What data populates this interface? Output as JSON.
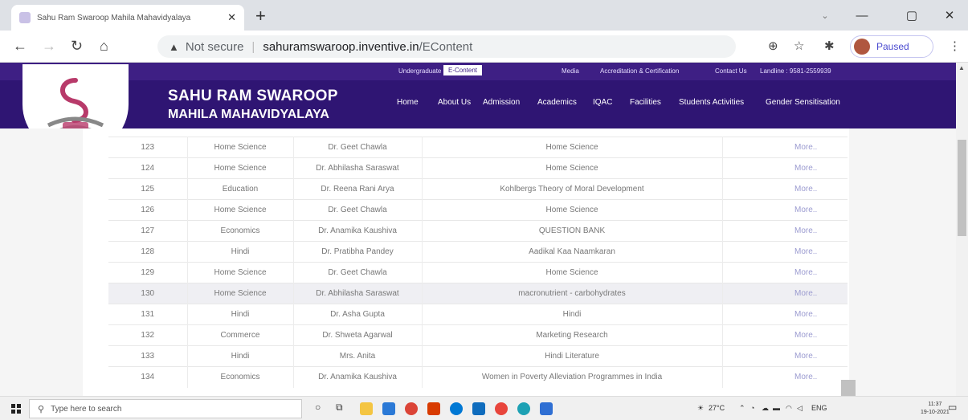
{
  "browser": {
    "tab_title": "Sahu Ram Swaroop Mahila Mahavidyalaya",
    "tab_close": "✕",
    "new_tab": "+",
    "security_label": "Not secure",
    "url_host": "sahuramswaroop.inventive.in",
    "url_path": "/EContent",
    "profile_label": "Paused"
  },
  "site": {
    "topbar": {
      "undergraduate": "Undergraduate",
      "econtent": "E-Content",
      "media": "Media",
      "accreditation": "Accreditation & Certification",
      "contact": "Contact Us",
      "landline": "Landline : 9581-2559939"
    },
    "brand_line1": "SAHU RAM SWAROOP",
    "brand_line2": "MAHILA MAHAVIDYALAYA",
    "nav": [
      "Home",
      "About Us",
      "Admission",
      "Academics",
      "IQAC",
      "Facilities",
      "Students Activities",
      "Gender Sensitisation"
    ]
  },
  "table": {
    "rows": [
      {
        "no": "123",
        "dept": "Home Science",
        "teacher": "Dr. Geet Chawla",
        "topic": "Home Science",
        "link": "More.."
      },
      {
        "no": "124",
        "dept": "Home Science",
        "teacher": "Dr. Abhilasha Saraswat",
        "topic": "Home Science",
        "link": "More.."
      },
      {
        "no": "125",
        "dept": "Education",
        "teacher": "Dr. Reena Rani Arya",
        "topic": "Kohlbergs Theory of Moral Development",
        "link": "More.."
      },
      {
        "no": "126",
        "dept": "Home Science",
        "teacher": "Dr. Geet Chawla",
        "topic": "Home Science",
        "link": "More.."
      },
      {
        "no": "127",
        "dept": "Economics",
        "teacher": "Dr. Anamika Kaushiva",
        "topic": "QUESTION BANK",
        "link": "More.."
      },
      {
        "no": "128",
        "dept": "Hindi",
        "teacher": "Dr. Pratibha Pandey",
        "topic": "Aadikal Kaa Naamkaran",
        "link": "More.."
      },
      {
        "no": "129",
        "dept": "Home Science",
        "teacher": "Dr. Geet Chawla",
        "topic": "Home Science",
        "link": "More.."
      },
      {
        "no": "130",
        "dept": "Home Science",
        "teacher": "Dr. Abhilasha Saraswat",
        "topic": "macronutrient - carbohydrates",
        "link": "More.."
      },
      {
        "no": "131",
        "dept": "Hindi",
        "teacher": "Dr. Asha Gupta",
        "topic": "Hindi",
        "link": "More.."
      },
      {
        "no": "132",
        "dept": "Commerce",
        "teacher": "Dr. Shweta Agarwal",
        "topic": "Marketing Research",
        "link": "More.."
      },
      {
        "no": "133",
        "dept": "Hindi",
        "teacher": "Mrs. Anita",
        "topic": "Hindi Literature",
        "link": "More.."
      },
      {
        "no": "134",
        "dept": "Economics",
        "teacher": "Dr. Anamika Kaushiva",
        "topic": "Women in Poverty Alleviation Programmes in India",
        "link": "More.."
      }
    ],
    "highlighted_row": "130"
  },
  "taskbar": {
    "search_placeholder": "Type here to search",
    "weather": "27°C",
    "language": "ENG",
    "time": "11:37",
    "date": "19-10-2021"
  },
  "colors": {
    "topbar": "#3e1f84",
    "navbar": "#2f1573",
    "link": "#9b9bd0"
  }
}
